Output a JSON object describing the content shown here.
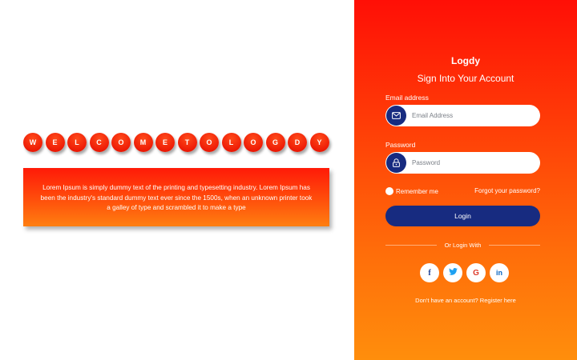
{
  "welcome": {
    "letters": [
      "W",
      "E",
      "L",
      "C",
      "O",
      "M",
      "E",
      "T",
      "O",
      "L",
      "O",
      "G",
      "D",
      "Y"
    ],
    "description": "Lorem Ipsum is simply dummy text of the printing and typesetting industry. Lorem Ipsum has been the industry's standard dummy text ever since the 1500s, when an unknown printer took a galley of type and scrambled it to make a type"
  },
  "login": {
    "brand": "Logdy",
    "title": "Sign Into Your Account",
    "email_label": "Email address",
    "email_placeholder": "Email Address",
    "email_value": "",
    "password_label": "Password",
    "password_placeholder": "Password",
    "password_value": "",
    "remember_label": "Remember me",
    "forgot_label": "Forgot your password?",
    "login_button": "Login",
    "or_login_with": "Or Login With",
    "social": [
      {
        "name": "facebook-icon",
        "glyph": "f",
        "color": "#1b3f95"
      },
      {
        "name": "twitter-icon",
        "glyph": "t",
        "color": "#1da1f2"
      },
      {
        "name": "google-icon",
        "glyph": "G",
        "color": "#dd3a2b"
      },
      {
        "name": "linkedin-icon",
        "glyph": "in",
        "color": "#0a66c2"
      }
    ],
    "signup_text": "Don't have an account? Register here"
  },
  "colors": {
    "accent_navy": "#172b80",
    "gradient_top": "#ff0f06",
    "gradient_bottom": "#ff8e0c"
  }
}
